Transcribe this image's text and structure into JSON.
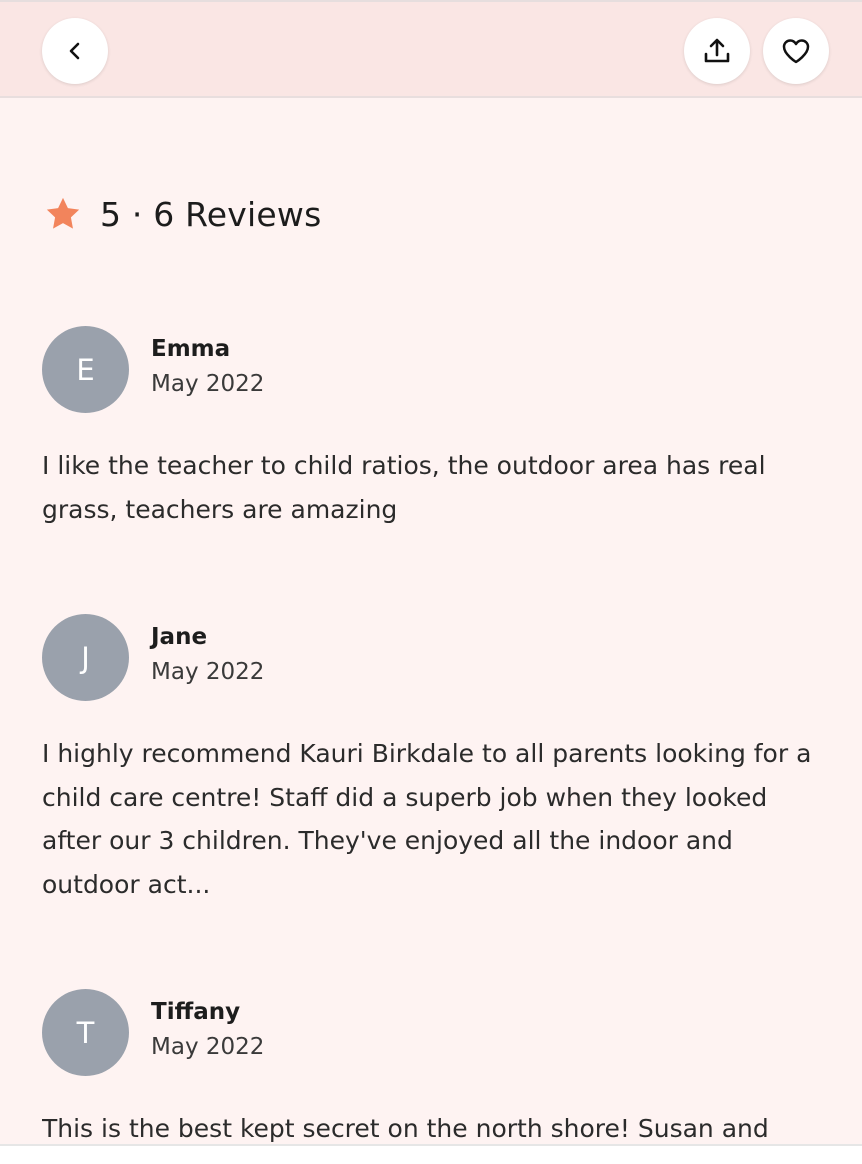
{
  "header": {
    "back_icon": "chevron-left-icon",
    "share_icon": "share-upload-icon",
    "favorite_icon": "heart-outline-icon"
  },
  "rating": {
    "star_icon": "star-icon",
    "star_color": "#f2845c",
    "summary": "5 · 6 Reviews"
  },
  "reviews": [
    {
      "initial": "E",
      "name": "Emma",
      "date": "May 2022",
      "text": "I like the teacher to child ratios, the outdoor area has real grass, teachers are amazing"
    },
    {
      "initial": "J",
      "name": "Jane",
      "date": "May 2022",
      "text": "I highly recommend Kauri Birkdale to all parents looking for a child care centre! Staff did a superb job when they looked after our 3 children. They've enjoyed all the indoor and outdoor act..."
    },
    {
      "initial": "T",
      "name": "Tiffany",
      "date": "May 2022",
      "text": "This is the best kept secret on the north shore! Susan and"
    }
  ],
  "colors": {
    "header_bg": "#fae6e4",
    "page_bg": "#fef3f2",
    "avatar_bg": "#9aa1ac"
  }
}
